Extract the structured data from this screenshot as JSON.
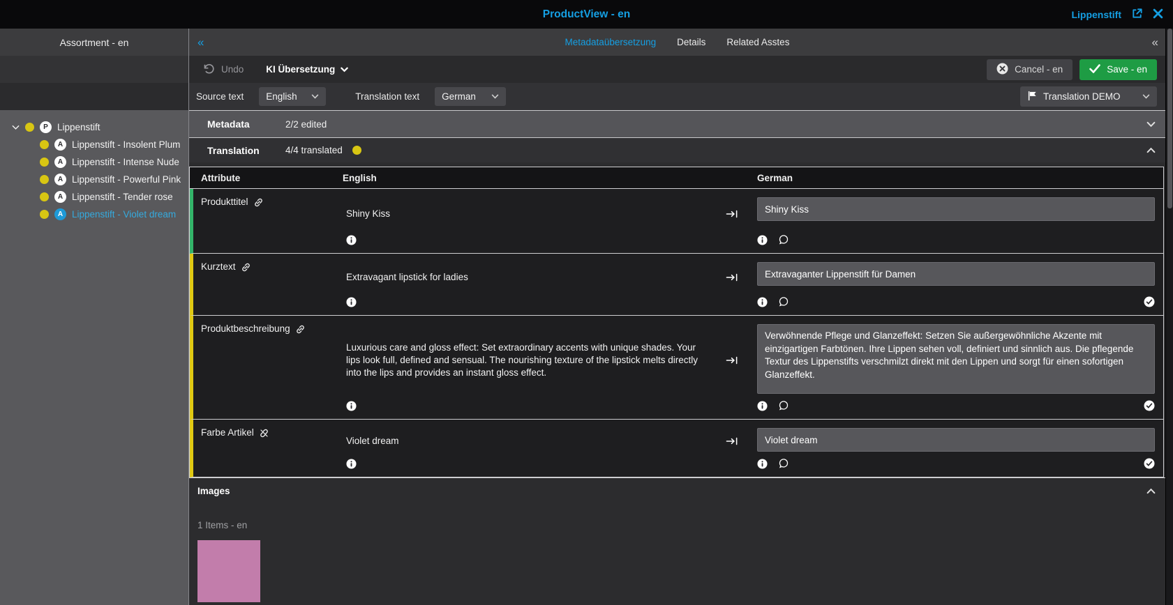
{
  "topbar": {
    "title": "ProductView - en",
    "context_label": "Lippenstift"
  },
  "sidebar": {
    "header": "Assortment - en",
    "tree": {
      "parent": {
        "label": "Lippenstift",
        "badge": "P",
        "expanded": true
      },
      "children": [
        {
          "label": "Lippenstift - Insolent Plum",
          "badge": "A",
          "selected": false
        },
        {
          "label": "Lippenstift - Intense Nude",
          "badge": "A",
          "selected": false
        },
        {
          "label": "Lippenstift - Powerful Pink",
          "badge": "A",
          "selected": false
        },
        {
          "label": "Lippenstift - Tender rose",
          "badge": "A",
          "selected": false
        },
        {
          "label": "Lippenstift - Violet dream",
          "badge": "A",
          "selected": true
        }
      ]
    }
  },
  "tabs": [
    {
      "label": "Metadataübersetzung",
      "active": true
    },
    {
      "label": "Details",
      "active": false
    },
    {
      "label": "Related Asstes",
      "active": false
    }
  ],
  "toolbar": {
    "undo_label": "Undo",
    "ki_label": "KI Übersetzung",
    "cancel_label": "Cancel - en",
    "save_label": "Save - en"
  },
  "language_bar": {
    "source_label": "Source text",
    "source_value": "English",
    "target_label": "Translation text",
    "target_value": "German",
    "profile_value": "Translation DEMO"
  },
  "sections": {
    "metadata": {
      "title": "Metadata",
      "status": "2/2 edited",
      "collapsed": true
    },
    "translation": {
      "title": "Translation",
      "status": "4/4 translated",
      "collapsed": false
    }
  },
  "table": {
    "columns": [
      "Attribute",
      "English",
      "German"
    ],
    "rows": [
      {
        "attribute": "Produkttitel",
        "linked": true,
        "accent": "green",
        "english": "Shiny Kiss",
        "german": "Shiny Kiss",
        "translated": false
      },
      {
        "attribute": "Kurztext",
        "linked": true,
        "accent": "yellow",
        "english": "Extravagant lipstick for ladies",
        "german": "Extravaganter Lippenstift für Damen",
        "translated": true
      },
      {
        "attribute": "Produktbeschreibung",
        "linked": true,
        "accent": "yellow",
        "english": "Luxurious care and gloss effect: Set extraordinary accents with unique shades. Your lips look full, defined and sensual. The nourishing texture of the lipstick melts directly into the lips and provides an instant gloss effect.",
        "german": "Verwöhnende Pflege und Glanzeffekt: Setzen Sie außergewöhnliche Akzente mit einzigartigen Farbtönen. Ihre Lippen sehen voll, definiert und sinnlich aus. Die pflegende Textur des Lippenstifts verschmilzt direkt mit den Lippen und sorgt für einen sofortigen Glanzeffekt.",
        "translated": true
      },
      {
        "attribute": "Farbe Artikel",
        "linked": false,
        "accent": "yellow",
        "english": "Violet dream",
        "german": "Violet dream",
        "translated": true
      }
    ]
  },
  "images_section": {
    "title": "Images",
    "count_label": "1 Items - en",
    "swatch_color": "#c27dab"
  },
  "colors": {
    "accent_cyan": "#159fe3",
    "save_green": "#1e9c44",
    "status_yellow": "#d8c613",
    "row_green": "#33b469",
    "row_yellow": "#e0c913"
  }
}
